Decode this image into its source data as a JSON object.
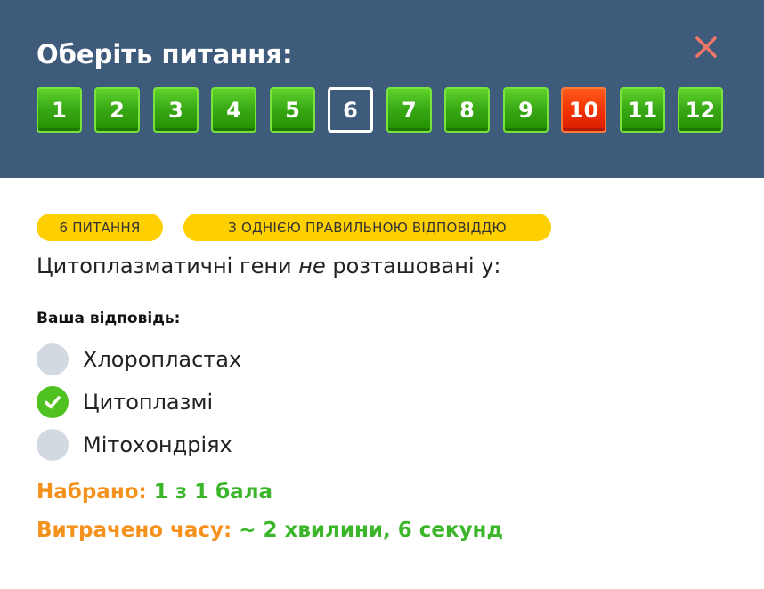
{
  "dialog": {
    "title": "Оберіть питання:",
    "close_icon": "close-icon",
    "close_color": "#f07766"
  },
  "questions": [
    {
      "label": "1",
      "state": "correct"
    },
    {
      "label": "2",
      "state": "correct"
    },
    {
      "label": "3",
      "state": "correct"
    },
    {
      "label": "4",
      "state": "correct"
    },
    {
      "label": "5",
      "state": "correct"
    },
    {
      "label": "6",
      "state": "current"
    },
    {
      "label": "7",
      "state": "correct"
    },
    {
      "label": "8",
      "state": "correct"
    },
    {
      "label": "9",
      "state": "correct"
    },
    {
      "label": "10",
      "state": "wrong"
    },
    {
      "label": "11",
      "state": "correct"
    },
    {
      "label": "12",
      "state": "correct"
    }
  ],
  "badges": {
    "number": "6 ПИТАННЯ",
    "type": "З ОДНІЄЮ ПРАВИЛЬНОЮ ВІДПОВІДДЮ"
  },
  "question": {
    "before": "Цитоплазматичні гени ",
    "emphasis": "не",
    "after": " розташовані у:"
  },
  "answer_label": "Ваша відповідь:",
  "options": [
    {
      "text": "Хлоропластах",
      "selected": false
    },
    {
      "text": "Цитоплазмі",
      "selected": true
    },
    {
      "text": "Мітохондріях",
      "selected": false
    }
  ],
  "result": {
    "score_label": "Набрано:",
    "score_value": "1 з 1 бала",
    "time_label": "Витрачено часу:",
    "time_value": "~ 2 хвилини, 6 секунд"
  },
  "colors": {
    "header_bg": "#3f5b7b",
    "correct": "#38a716",
    "wrong": "#f03000",
    "badge": "#ffd000",
    "label_orange": "#f5921e",
    "value_green": "#3bb62a"
  }
}
